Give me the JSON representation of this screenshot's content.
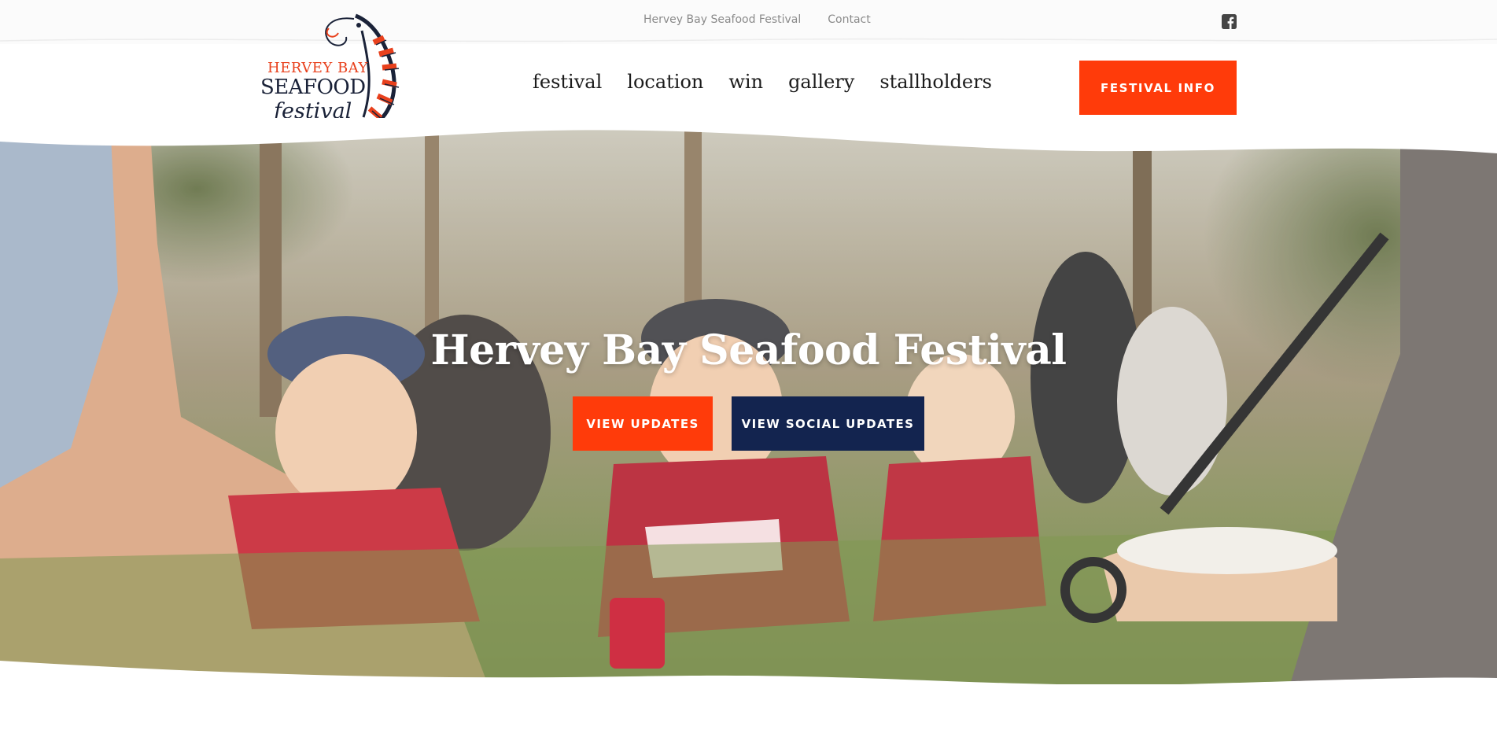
{
  "topbar": {
    "links": [
      "Hervey Bay Seafood Festival",
      "Contact"
    ],
    "social_icon": "facebook-icon"
  },
  "logo": {
    "line1": "HERVEY BAY",
    "line2": "SEAFOOD",
    "line3": "festival"
  },
  "nav": {
    "items": [
      "festival",
      "location",
      "win",
      "gallery",
      "stallholders"
    ]
  },
  "header": {
    "cta_label": "FESTIVAL INFO"
  },
  "hero": {
    "title": "Hervey Bay Seafood Festival",
    "primary_button": "VIEW UPDATES",
    "secondary_button": "VIEW SOCIAL UPDATES"
  },
  "colors": {
    "accent_orange": "#ff3b0a",
    "navy": "#13244f",
    "logo_orange": "#e8401c",
    "logo_navy": "#1a2238"
  }
}
